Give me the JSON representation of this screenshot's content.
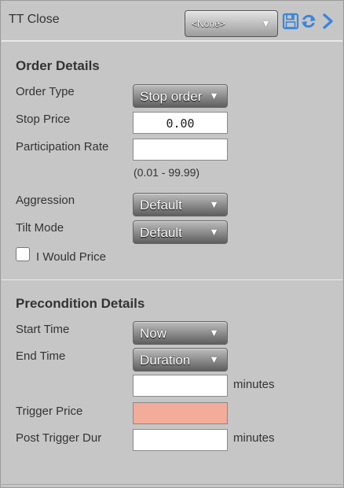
{
  "header": {
    "title": "TT Close",
    "preset_value": "<None>",
    "icons": [
      "save-icon",
      "refresh-icon",
      "chevron-right-icon"
    ]
  },
  "order_details": {
    "title": "Order Details",
    "order_type_label": "Order Type",
    "order_type_value": "Stop order",
    "stop_price_label": "Stop Price",
    "stop_price_value": "0.00",
    "participation_rate_label": "Participation Rate",
    "participation_rate_value": "",
    "participation_rate_range": "(0.01 - 99.99)",
    "aggression_label": "Aggression",
    "aggression_value": "Default",
    "tilt_mode_label": "Tilt Mode",
    "tilt_mode_value": "Default",
    "i_would_price_label": "I Would Price"
  },
  "precondition_details": {
    "title": "Precondition Details",
    "start_time_label": "Start Time",
    "start_time_value": "Now",
    "end_time_label": "End Time",
    "end_time_value": "Duration",
    "duration_value": "",
    "duration_unit": "minutes",
    "trigger_price_label": "Trigger Price",
    "trigger_price_value": "",
    "post_trigger_dur_label": "Post Trigger Dur",
    "post_trigger_dur_value": "",
    "post_trigger_dur_unit": "minutes"
  },
  "colors": {
    "panel_bg": "#c6c6c6",
    "icon_blue": "#3b86d9",
    "trigger_price_field": "#f3ab9a"
  }
}
